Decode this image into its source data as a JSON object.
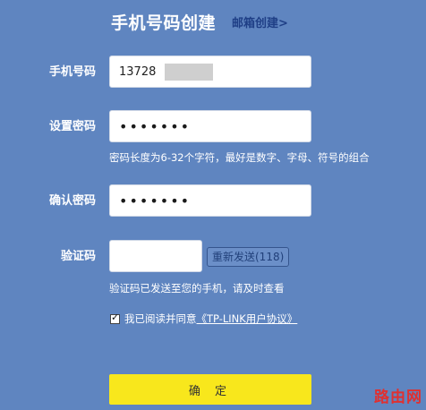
{
  "header": {
    "title": "手机号码创建",
    "alt_link": "邮箱创建>"
  },
  "form": {
    "phone": {
      "label": "手机号码",
      "value": "13728"
    },
    "password": {
      "label": "设置密码",
      "masked_value": "•••••••",
      "hint": "密码长度为6-32个字符，最好是数字、字母、符号的组合"
    },
    "confirm_password": {
      "label": "确认密码",
      "masked_value": "•••••••"
    },
    "captcha": {
      "label": "验证码",
      "value": "",
      "resend_label": "重新发送(118)",
      "hint": "验证码已发送至您的手机，请及时查看"
    },
    "agreement": {
      "checked": true,
      "text": "我已阅读并同意",
      "link": "《TP-LINK用户协议》"
    },
    "submit_label": "确 定"
  },
  "watermark": "路由网",
  "colors": {
    "background": "#5f85c0",
    "button": "#f8e71c",
    "link": "#1f3f86"
  }
}
